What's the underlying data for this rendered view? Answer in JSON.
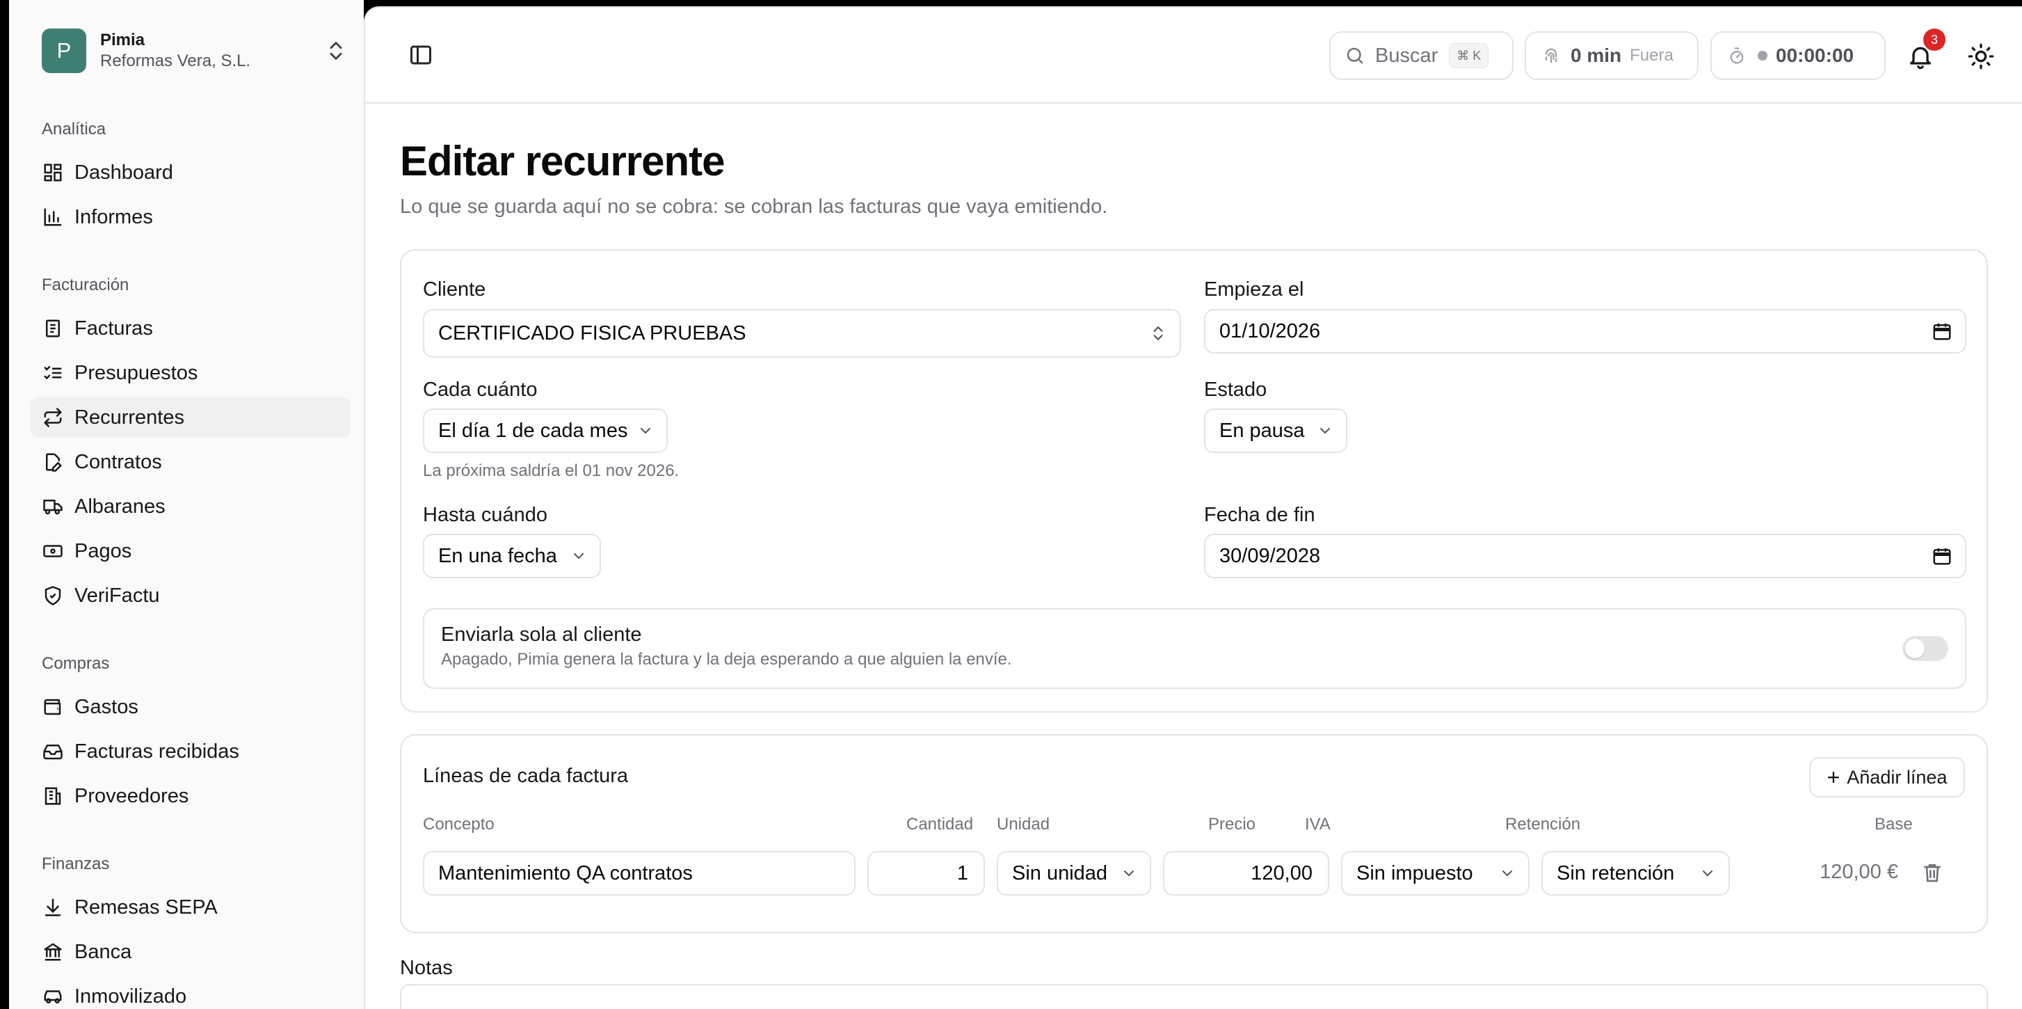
{
  "workspace": {
    "initial": "P",
    "name": "Pimia",
    "company": "Reformas Vera, S.L."
  },
  "sidebar": {
    "sections": [
      {
        "title": "Analítica",
        "items": [
          {
            "label": "Dashboard",
            "icon": "dashboard-icon"
          },
          {
            "label": "Informes",
            "icon": "bar-chart-icon"
          }
        ]
      },
      {
        "title": "Facturación",
        "items": [
          {
            "label": "Facturas",
            "icon": "receipt-icon"
          },
          {
            "label": "Presupuestos",
            "icon": "list-checks-icon"
          },
          {
            "label": "Recurrentes",
            "icon": "repeat-icon",
            "active": true
          },
          {
            "label": "Contratos",
            "icon": "file-pen-icon"
          },
          {
            "label": "Albaranes",
            "icon": "truck-icon"
          },
          {
            "label": "Pagos",
            "icon": "banknote-icon"
          },
          {
            "label": "VeriFactu",
            "icon": "shield-check-icon"
          }
        ]
      },
      {
        "title": "Compras",
        "items": [
          {
            "label": "Gastos",
            "icon": "wallet-icon"
          },
          {
            "label": "Facturas recibidas",
            "icon": "inbox-icon"
          },
          {
            "label": "Proveedores",
            "icon": "building-icon"
          }
        ]
      },
      {
        "title": "Finanzas",
        "items": [
          {
            "label": "Remesas SEPA",
            "icon": "download-icon"
          },
          {
            "label": "Banca",
            "icon": "bank-icon"
          },
          {
            "label": "Inmovilizado",
            "icon": "car-icon"
          }
        ]
      }
    ]
  },
  "topbar": {
    "search_label": "Buscar",
    "search_shortcut": "⌘ K",
    "clock_value": "0 min",
    "clock_status": "Fuera",
    "timer_value": "00:00:00",
    "notifications_count": "3"
  },
  "page": {
    "title": "Editar recurrente",
    "subtitle": "Lo que se guarda aquí no se cobra: se cobran las facturas que vaya emitiendo."
  },
  "form": {
    "client_label": "Cliente",
    "client_value": "CERTIFICADO FISICA PRUEBAS",
    "start_label": "Empieza el",
    "start_value": "01/10/2026",
    "frequency_label": "Cada cuánto",
    "frequency_value": "El día 1 de cada mes",
    "frequency_help": "La próxima saldría el 01 nov 2026.",
    "status_label": "Estado",
    "status_value": "En pausa",
    "until_label": "Hasta cuándo",
    "until_value": "En una fecha",
    "end_label": "Fecha de fin",
    "end_value": "30/09/2028",
    "auto_send_title": "Enviarla sola al cliente",
    "auto_send_desc": "Apagado, Pimia genera la factura y la deja esperando a que alguien la envíe.",
    "auto_send_on": false
  },
  "lines": {
    "title": "Líneas de cada factura",
    "add_label": "Añadir línea",
    "columns": {
      "concept": "Concepto",
      "quantity": "Cantidad",
      "unit": "Unidad",
      "price": "Precio",
      "vat": "IVA",
      "retention": "Retención",
      "base": "Base"
    },
    "rows": [
      {
        "concept": "Mantenimiento QA contratos",
        "quantity": "1",
        "unit": "Sin unidad",
        "price": "120,00",
        "vat": "Sin impuesto",
        "retention": "Sin retención",
        "base": "120,00 €"
      }
    ]
  },
  "notes": {
    "label": "Notas"
  },
  "colors": {
    "accent": "#3f7f73",
    "badge": "#dc2626",
    "border": "#e4e4e7",
    "muted": "#71717a"
  }
}
